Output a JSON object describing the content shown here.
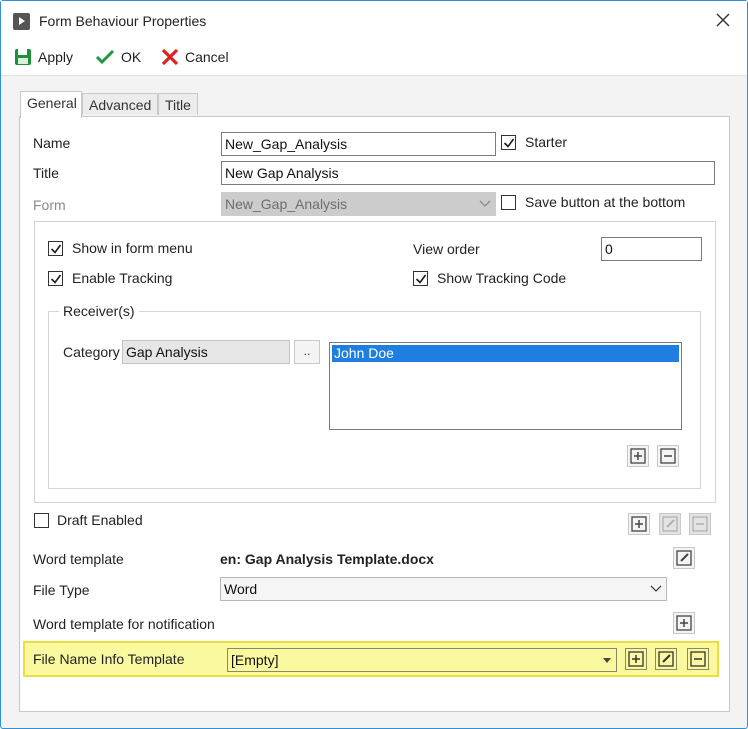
{
  "window": {
    "title": "Form Behaviour Properties"
  },
  "toolbar": {
    "apply_label": "Apply",
    "ok_label": "OK",
    "cancel_label": "Cancel"
  },
  "tabs": [
    {
      "label": "General",
      "active": true
    },
    {
      "label": "Advanced"
    },
    {
      "label": "Title"
    }
  ],
  "general": {
    "name_label": "Name",
    "name_value": "New_Gap_Analysis",
    "starter_label": "Starter",
    "starter_checked": true,
    "title_label": "Title",
    "title_value": "New Gap Analysis",
    "form_label": "Form",
    "form_value": "New_Gap_Analysis",
    "save_bottom_label": "Save button at the bottom",
    "save_bottom_checked": false,
    "show_in_menu_label": "Show in form menu",
    "show_in_menu_checked": true,
    "enable_tracking_label": "Enable Tracking",
    "enable_tracking_checked": true,
    "view_order_label": "View order",
    "view_order_value": "0",
    "show_tracking_label": "Show Tracking Code",
    "show_tracking_checked": true,
    "receivers_legend": "Receiver(s)",
    "category_label": "Category",
    "category_value": "Gap Analysis",
    "browse_label": "..",
    "receivers": [
      "John Doe"
    ],
    "draft_label": "Draft Enabled",
    "draft_checked": false,
    "word_template_label": "Word template",
    "word_template_value": "en: Gap Analysis Template.docx",
    "file_type_label": "File Type",
    "file_type_value": "Word",
    "notification_template_label": "Word template for notification",
    "file_name_info_label": "File Name Info Template",
    "file_name_info_value": "[Empty]"
  },
  "colors": {
    "accent": "#2e8fd8",
    "highlight": "#fbf9a0",
    "selection": "#1e7fe0"
  }
}
